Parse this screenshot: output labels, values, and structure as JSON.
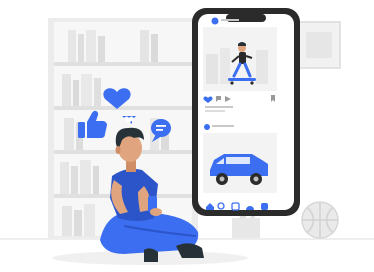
{
  "scene": {
    "subject": "person-sitting-with-phone-social-media",
    "colors": {
      "accent": "#3b6ef0",
      "accent_dark": "#2b55c8",
      "shelf_light": "#f2f2f2",
      "shelf_mid": "#e3e3e3",
      "shelf_dark": "#d4d4d4",
      "phone_frame": "#2b2b2b",
      "skin": "#e0a47e",
      "hair": "#263238"
    },
    "icons": [
      "heart-icon",
      "thumbs-up-icon",
      "chat-bubble-icon",
      "home-icon",
      "search-icon",
      "add-icon",
      "profile-icon"
    ]
  }
}
